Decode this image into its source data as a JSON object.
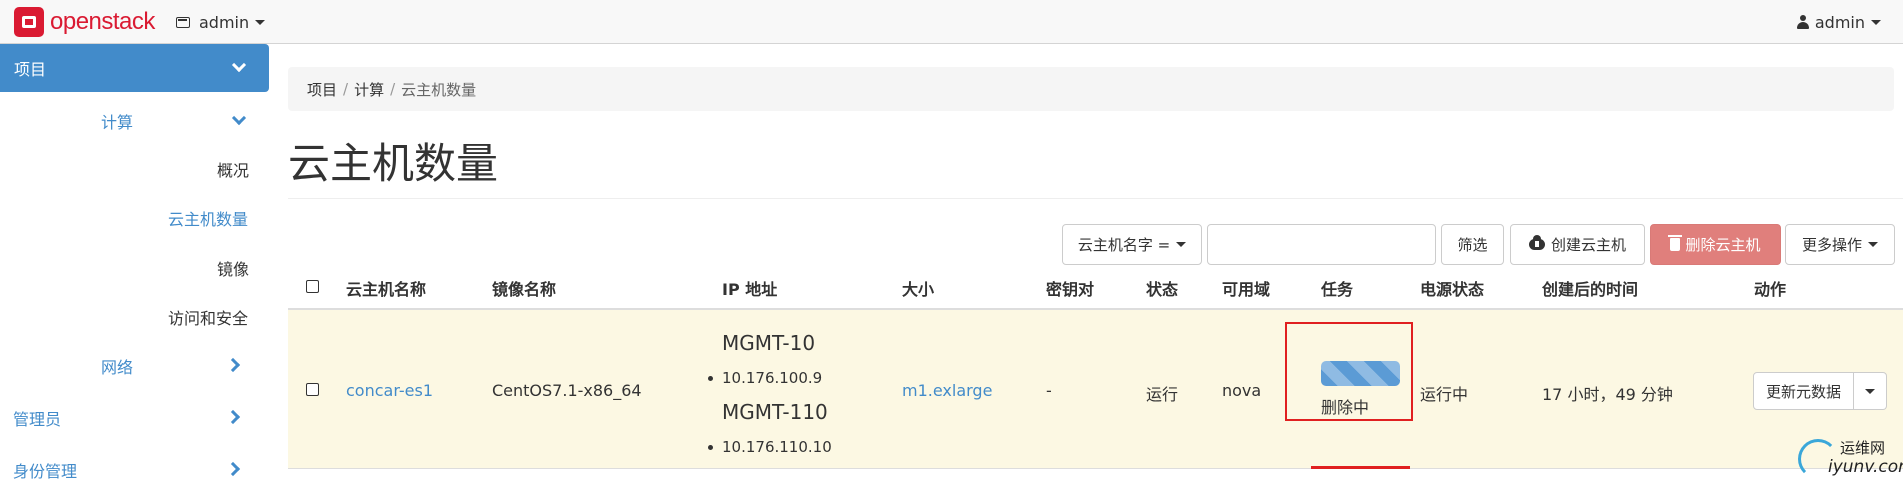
{
  "navbar": {
    "brand": "openstack",
    "project": "admin",
    "user": "admin"
  },
  "sidebar": {
    "project": "项目",
    "compute": "计算",
    "overview": "概况",
    "instances": "云主机数量",
    "images": "镜像",
    "access_security": "访问和安全",
    "network": "网络",
    "admin": "管理员",
    "identity": "身份管理"
  },
  "breadcrumb": [
    "项目",
    "计算",
    "云主机数量"
  ],
  "page_title": "云主机数量",
  "toolbar": {
    "filter_field": "云主机名字 =",
    "search_value": "",
    "filter_button": "筛选",
    "launch_button": "创建云主机",
    "delete_button": "删除云主机",
    "more_button": "更多操作"
  },
  "table": {
    "headers": [
      "云主机名称",
      "镜像名称",
      "IP 地址",
      "大小",
      "密钥对",
      "状态",
      "可用域",
      "任务",
      "电源状态",
      "创建后的时间",
      "动作"
    ],
    "rows": [
      {
        "name": "concar-es1",
        "image": "CentOS7.1-x86_64",
        "ip_groups": [
          {
            "network": "MGMT-10",
            "address": "10.176.100.9"
          },
          {
            "network": "MGMT-110",
            "address": "10.176.110.10"
          }
        ],
        "size": "m1.exlarge",
        "keypair": "-",
        "status": "运行",
        "availability_zone": "nova",
        "task": "删除中",
        "power_state": "运行中",
        "age": "17 小时，49 分钟",
        "action": "更新元数据"
      }
    ]
  },
  "colors": {
    "brand": "#da1a32",
    "primary": "#428bca",
    "danger_button": "#e07f7c",
    "row_highlight": "#fcf8e3",
    "annotation_box": "#e02020"
  },
  "watermark": {
    "line1": "运维网",
    "line2": "iyunv.com"
  }
}
